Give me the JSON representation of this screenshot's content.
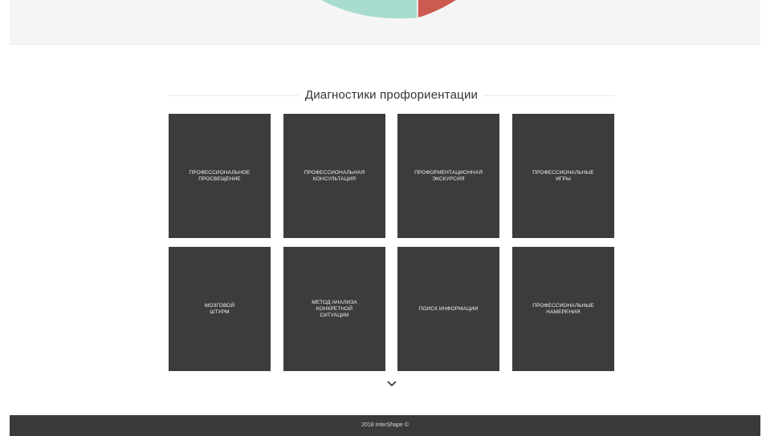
{
  "section": {
    "title": "Диагностики профориентации"
  },
  "tiles": [
    {
      "label": "ПРОФЕССИОНАЛЬНОЕ\nПРОСВЕЩЕНИЕ"
    },
    {
      "label": "ПРОФЕССИОНАЛЬНАЯ\nКОНСУЛЬТАЦИЯ"
    },
    {
      "label": "ПРОФОРИЕНТАЦИОННАЯ\nЭКСКУРСИЯ"
    },
    {
      "label": "ПРОФЕССИОНАЛЬНЫЕ\nИГРЫ"
    },
    {
      "label": "МОЗГОВОЙ\nШТУРМ"
    },
    {
      "label": "МЕТОД АНАЛИЗА\nКОНКРЕТНОЙ\nСИТУАЦИИ"
    },
    {
      "label": "ПОИСК ИНФОРМАЦИИ"
    },
    {
      "label": "ПРОФЕССИОНАЛЬНЫЕ\nНАМЕРЕНИЯ"
    }
  ],
  "footer": {
    "text": "2018 InterShape ©"
  },
  "colors": {
    "pie_teal": "#a8dcd0",
    "pie_red": "#cc5a50",
    "tile_bg": "#3c3c3c",
    "footer_bg": "#3a3a3a"
  },
  "icons": {
    "scroll": "chevron-down-icon"
  }
}
